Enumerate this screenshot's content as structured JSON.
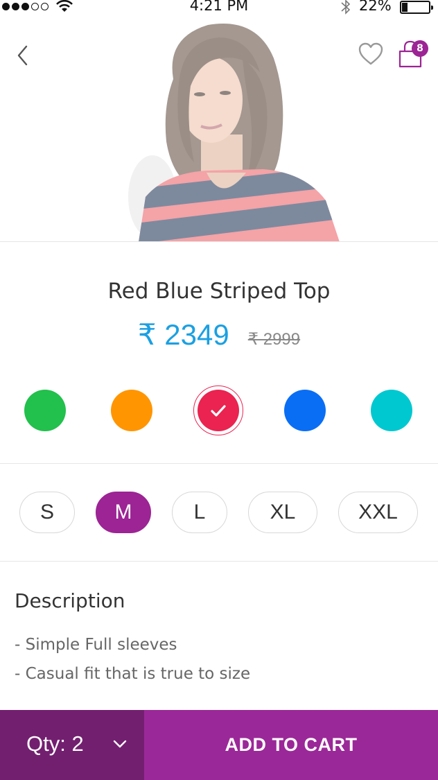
{
  "status_bar": {
    "time": "4:21 PM",
    "battery_percent": "22%",
    "signal_bars_filled": 3,
    "signal_bars_total": 5,
    "battery_level": 0.22
  },
  "header": {
    "back_icon": "chevron-left-icon",
    "wishlist_icon": "heart-icon",
    "bag_icon": "shopping-bag-icon",
    "bag_count": "8"
  },
  "product": {
    "name": "Red Blue Striped Top",
    "price": "₹ 2349",
    "mrp": "₹ 2999"
  },
  "colors": {
    "selected_index": 2,
    "options": [
      {
        "name": "green",
        "hex": "#22c04c"
      },
      {
        "name": "orange",
        "hex": "#ff9500"
      },
      {
        "name": "red",
        "hex": "#ea2350"
      },
      {
        "name": "blue",
        "hex": "#0a6ef5"
      },
      {
        "name": "teal",
        "hex": "#00c8d0"
      }
    ]
  },
  "sizes": {
    "selected": "M",
    "options": [
      "S",
      "M",
      "L",
      "XL",
      "XXL"
    ]
  },
  "description": {
    "title": "Description",
    "items": [
      "- Simple Full sleeves",
      "- Casual fit that is true to size"
    ]
  },
  "cart_bar": {
    "qty_label": "Qty: 2",
    "add_label": "ADD TO CART"
  },
  "theme": {
    "accent": "#9c2494",
    "accent_dark": "#731f70",
    "price_color": "#1ba0e2"
  }
}
